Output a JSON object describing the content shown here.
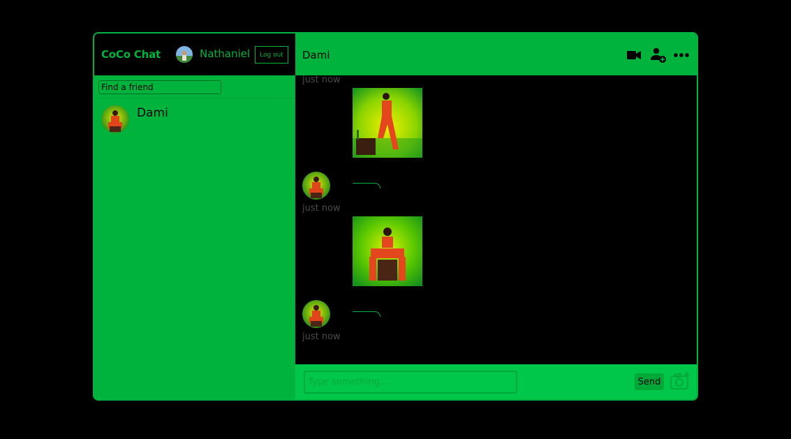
{
  "app": {
    "brand": "CoCo Chat",
    "accent_color": "#00b33c",
    "background_color": "#000000"
  },
  "current_user": {
    "name": "Nathaniel",
    "logout_label": "Log out"
  },
  "sidebar": {
    "search_placeholder": "Find a friend",
    "chats": [
      {
        "name": "Dami"
      }
    ]
  },
  "chat": {
    "title": "Dami",
    "header_icons": [
      "video-camera-icon",
      "add-user-icon",
      "more-options-icon"
    ],
    "messages": [
      {
        "time": "just now",
        "type": "image"
      },
      {
        "time": "just now",
        "type": "image"
      },
      {
        "time": "just now",
        "type": "text",
        "text": ""
      }
    ],
    "input_placeholder": "Type something...",
    "send_label": "Send",
    "attach_icon": "add-image-icon"
  }
}
